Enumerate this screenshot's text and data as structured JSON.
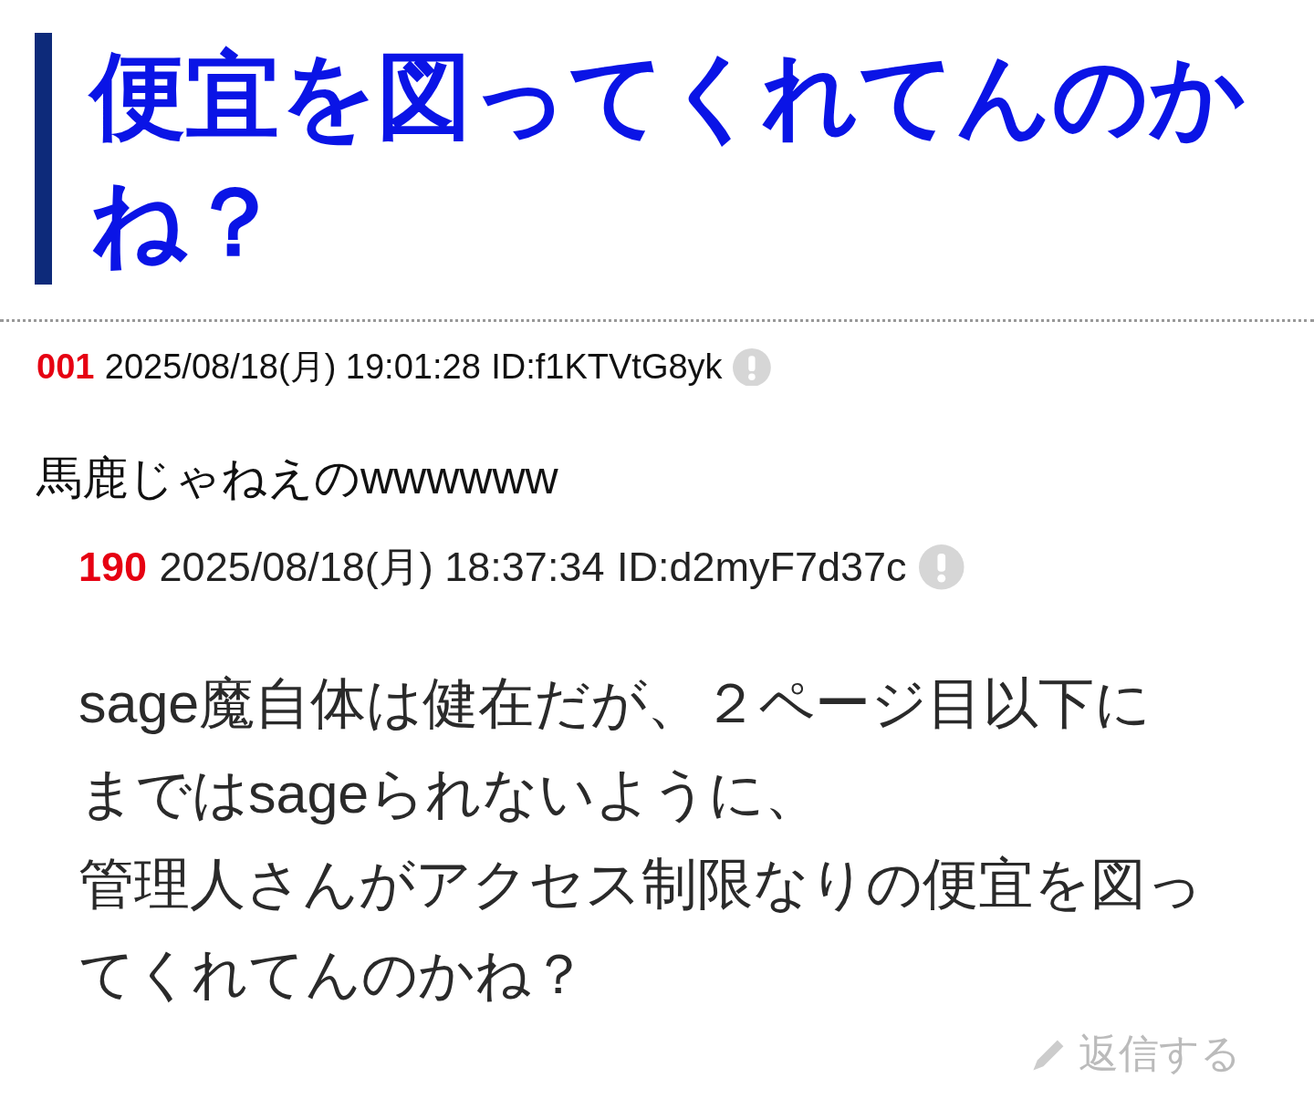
{
  "title": "便宜を図ってくれてんのかね？",
  "post": {
    "number": "001",
    "date": "2025/08/18(月) 19:01:28",
    "id": "ID:f1KTVtG8yk",
    "body": "馬鹿じゃねえのwwwwww"
  },
  "quoted_post": {
    "number": "190",
    "date": "2025/08/18(月) 18:37:34",
    "id": "ID:d2myF7d37c",
    "lines": [
      "sage魔自体は健在だが、２ページ目以下に",
      "まではsageられないように、",
      "管理人さんがアクセス制限なりの便宜を図っ",
      "てくれてんのかね？"
    ],
    "reply_link": "返信する"
  }
}
